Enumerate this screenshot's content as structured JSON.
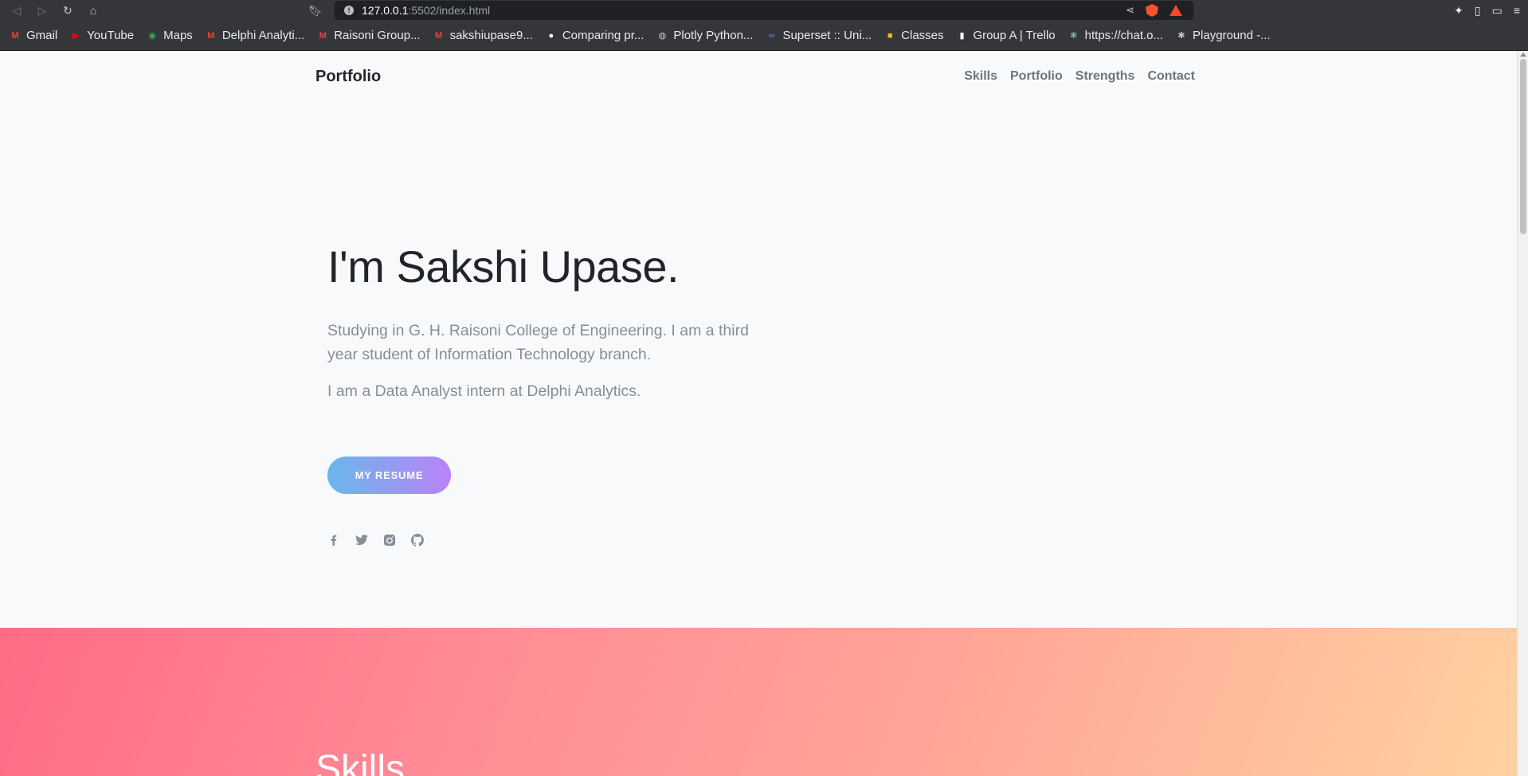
{
  "browser": {
    "url_host": "127.0.0.1",
    "url_rest": ":5502/index.html",
    "bookmarks": [
      {
        "label": "Gmail",
        "icon": "gmail-icon",
        "color": "#ea4335",
        "glyph": "M"
      },
      {
        "label": "YouTube",
        "icon": "youtube-icon",
        "color": "#ff0000",
        "glyph": "▶"
      },
      {
        "label": "Maps",
        "icon": "maps-icon",
        "color": "#34a853",
        "glyph": "◉"
      },
      {
        "label": "Delphi Analyti...",
        "icon": "gmail-icon",
        "color": "#ea4335",
        "glyph": "M"
      },
      {
        "label": "Raisoni Group...",
        "icon": "gmail-icon",
        "color": "#ea4335",
        "glyph": "M"
      },
      {
        "label": "sakshiupase9...",
        "icon": "gmail-icon",
        "color": "#ea4335",
        "glyph": "M"
      },
      {
        "label": "Comparing pr...",
        "icon": "github-icon",
        "color": "#ffffff",
        "glyph": "●"
      },
      {
        "label": "Plotly Python...",
        "icon": "globe-icon",
        "color": "#c8c8c8",
        "glyph": "◍"
      },
      {
        "label": "Superset :: Uni...",
        "icon": "superset-icon",
        "color": "#5a6fd6",
        "glyph": "∞"
      },
      {
        "label": "Classes",
        "icon": "classroom-icon",
        "color": "#fbbc04",
        "glyph": "■"
      },
      {
        "label": "Group A | Trello",
        "icon": "trello-icon",
        "color": "#ffffff",
        "glyph": "▮"
      },
      {
        "label": "https://chat.o...",
        "icon": "openai-icon",
        "color": "#74aa9c",
        "glyph": "✱"
      },
      {
        "label": "Playground -...",
        "icon": "openai-icon",
        "color": "#c8c8c8",
        "glyph": "✱"
      }
    ]
  },
  "site": {
    "brand": "Portfolio",
    "nav": [
      "Skills",
      "Portfolio",
      "Strengths",
      "Contact"
    ],
    "hero": {
      "title": "I'm Sakshi Upase.",
      "para1": "Studying in G. H. Raisoni College of Engineering. I am a third year student of Information Technology branch.",
      "para2": "I am a Data Analyst intern at Delphi Analytics.",
      "button": "MY RESUME"
    },
    "socials": [
      "facebook-icon",
      "twitter-icon",
      "instagram-icon",
      "github-icon"
    ],
    "skills_title": "Skills"
  }
}
